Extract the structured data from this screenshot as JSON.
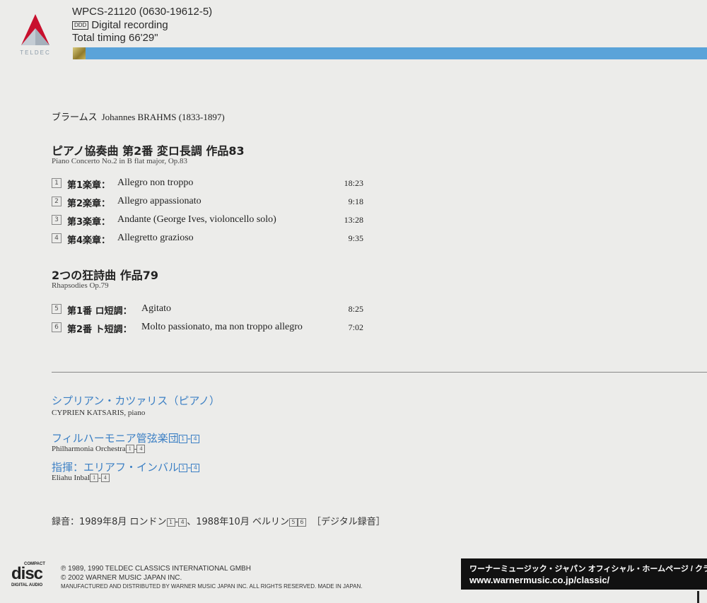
{
  "header": {
    "label_brand": "TELDEC",
    "catalog": "WPCS-21120 (0630-19612-5)",
    "ddd": "DDD",
    "recording": "Digital recording",
    "timing": "Total timing 66'29\""
  },
  "composer": {
    "jp": "ブラームス",
    "en": "Johannes BRAHMS (1833-1897)"
  },
  "works": [
    {
      "title_jp": "ピアノ協奏曲 第2番 変ロ長調 作品83",
      "title_en": "Piano Concerto No.2 in B flat major, Op.83",
      "tracks": [
        {
          "num": "1",
          "jp": "第1楽章：",
          "en": "Allegro non troppo",
          "time": "18:23"
        },
        {
          "num": "2",
          "jp": "第2楽章：",
          "en": "Allegro appassionato",
          "time": "9:18"
        },
        {
          "num": "3",
          "jp": "第3楽章：",
          "en": "Andante (George Ives, violoncello solo)",
          "time": "13:28"
        },
        {
          "num": "4",
          "jp": "第4楽章：",
          "en": "Allegretto grazioso",
          "time": "9:35"
        }
      ]
    },
    {
      "title_jp": "2つの狂詩曲 作品79",
      "title_en": "Rhapsodies Op.79",
      "tracks": [
        {
          "num": "5",
          "jp": "第1番 ロ短調：",
          "en": "Agitato",
          "time": "8:25"
        },
        {
          "num": "6",
          "jp": "第2番 ト短調：",
          "en": "Molto passionato, ma non troppo allegro",
          "time": "7:02"
        }
      ]
    }
  ],
  "performers": {
    "pianist_jp": "シプリアン・カツァリス（ピアノ）",
    "pianist_en": "CYPRIEN KATSARIS, piano",
    "orchestra_jp": "フィルハーモニア管弦楽団",
    "orchestra_en": "Philharmonia Orchestra",
    "conductor_jp": "指揮：エリアフ・インバル",
    "conductor_en": "Eliahu Inbal",
    "range_from": "1",
    "range_to": "4",
    "dash": "-"
  },
  "recording_note": {
    "part1": "録音：1989年8月 ロンドン",
    "t1": "1",
    "dash": "-",
    "t4": "4",
    "part2": "、1988年10月 ベルリン",
    "t5": "5",
    "t6": "6",
    "part3": "［デジタル録音］"
  },
  "disc_logo": {
    "top": "COMPACT",
    "main": "disc",
    "bottom": "DIGITAL AUDIO"
  },
  "copyright": [
    "℗ 1989, 1990 TELDEC CLASSICS INTERNATIONAL GMBH",
    "© 2002 WARNER MUSIC JAPAN INC.",
    "MANUFACTURED AND DISTRIBUTED BY WARNER MUSIC JAPAN INC. ALL RIGHTS RESERVED. MADE IN JAPAN."
  ],
  "website": {
    "jp": "ワーナーミュージック・ジャパン オフィシャル・ホームページ / クラシック：",
    "url": "www.warnermusic.co.jp/classic/"
  },
  "colors": {
    "accent_blue": "#5aa3d9",
    "text_blue": "#3b7fc4",
    "logo_red": "#c8102e"
  }
}
